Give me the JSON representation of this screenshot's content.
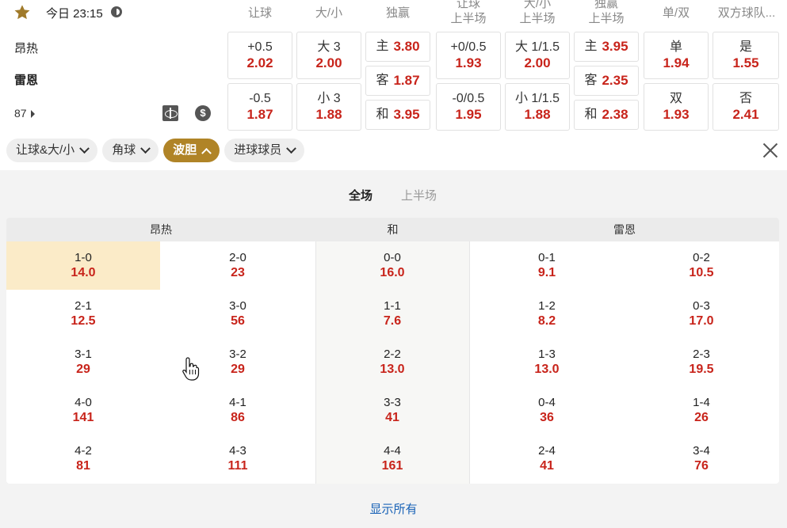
{
  "header": {
    "time": "今日 23:15",
    "home_team": "昂热",
    "away_team": "雷恩",
    "minute": "87"
  },
  "market_headers": {
    "handicap": "让球",
    "over_under": "大/小",
    "moneyline": "独赢",
    "handicap_1h_a": "让球",
    "handicap_1h_b": "上半场",
    "ou_1h_a": "大/小",
    "ou_1h_b": "上半场",
    "ml_1h_a": "独赢",
    "ml_1h_b": "上半场",
    "odd_even": "单/双",
    "btts": "双方球队..."
  },
  "markets": {
    "handicap": [
      {
        "label": "+0.5",
        "odds": "2.02"
      },
      {
        "label": "-0.5",
        "odds": "1.87"
      }
    ],
    "over_under": [
      {
        "label": "大 3",
        "odds": "2.00"
      },
      {
        "label": "小 3",
        "odds": "1.88"
      }
    ],
    "moneyline": [
      {
        "label": "主",
        "odds": "3.80"
      },
      {
        "label": "客",
        "odds": "1.87"
      },
      {
        "label": "和",
        "odds": "3.95"
      }
    ],
    "handicap_1h": [
      {
        "label": "+0/0.5",
        "odds": "1.93"
      },
      {
        "label": "-0/0.5",
        "odds": "1.95"
      }
    ],
    "ou_1h": [
      {
        "label": "大 1/1.5",
        "odds": "2.00"
      },
      {
        "label": "小 1/1.5",
        "odds": "1.88"
      }
    ],
    "ml_1h": [
      {
        "label": "主",
        "odds": "3.95"
      },
      {
        "label": "客",
        "odds": "2.35"
      },
      {
        "label": "和",
        "odds": "2.38"
      }
    ],
    "odd_even": [
      {
        "label": "单",
        "odds": "1.94"
      },
      {
        "label": "双",
        "odds": "1.93"
      }
    ],
    "btts": [
      {
        "label": "是",
        "odds": "1.55"
      },
      {
        "label": "否",
        "odds": "2.41"
      }
    ]
  },
  "filter_tabs": [
    {
      "label": "让球&大/小",
      "active": false
    },
    {
      "label": "角球",
      "active": false
    },
    {
      "label": "波胆",
      "active": true
    },
    {
      "label": "进球球员",
      "active": false
    }
  ],
  "period_tabs": {
    "full": "全场",
    "half": "上半场"
  },
  "correct_score": {
    "headers": {
      "home": "昂热",
      "draw": "和",
      "away": "雷恩"
    },
    "rows": [
      [
        {
          "s": "1-0",
          "o": "14.0"
        },
        {
          "s": "2-0",
          "o": "23"
        },
        {
          "s": "0-0",
          "o": "16.0"
        },
        {
          "s": "0-1",
          "o": "9.1"
        },
        {
          "s": "0-2",
          "o": "10.5"
        }
      ],
      [
        {
          "s": "2-1",
          "o": "12.5"
        },
        {
          "s": "3-0",
          "o": "56"
        },
        {
          "s": "1-1",
          "o": "7.6"
        },
        {
          "s": "1-2",
          "o": "8.2"
        },
        {
          "s": "0-3",
          "o": "17.0"
        }
      ],
      [
        {
          "s": "3-1",
          "o": "29"
        },
        {
          "s": "3-2",
          "o": "29"
        },
        {
          "s": "2-2",
          "o": "13.0"
        },
        {
          "s": "1-3",
          "o": "13.0"
        },
        {
          "s": "2-3",
          "o": "19.5"
        }
      ],
      [
        {
          "s": "4-0",
          "o": "141"
        },
        {
          "s": "4-1",
          "o": "86"
        },
        {
          "s": "3-3",
          "o": "41"
        },
        {
          "s": "0-4",
          "o": "36"
        },
        {
          "s": "1-4",
          "o": "26"
        }
      ],
      [
        {
          "s": "4-2",
          "o": "81"
        },
        {
          "s": "4-3",
          "o": "111"
        },
        {
          "s": "4-4",
          "o": "161"
        },
        {
          "s": "2-4",
          "o": "41"
        },
        {
          "s": "3-4",
          "o": "76"
        }
      ]
    ]
  },
  "show_all": "显示所有",
  "colors": {
    "accent": "#b08427",
    "odds": "#c8241b",
    "highlight": "#fbebc8",
    "link": "#1a63b7"
  }
}
